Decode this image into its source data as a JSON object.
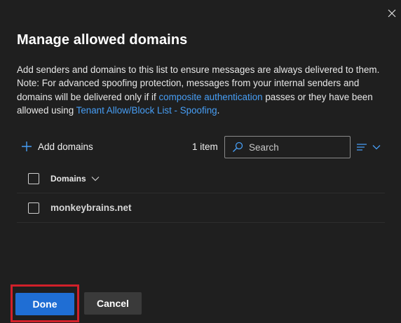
{
  "dialog": {
    "title": "Manage allowed domains",
    "close_icon": "close-icon",
    "description": {
      "text_before_link1": "Add senders and domains to this list to ensure messages are always delivered to them. Note: For advanced spoofing protection, messages from your internal senders and domains will be delivered only if if ",
      "link1": "composite authentication",
      "text_between_links": " passes or they have been allowed using ",
      "link2": "Tenant Allow/Block List - Spoofing",
      "text_after_link2": "."
    }
  },
  "toolbar": {
    "add_icon": "plus-icon",
    "add_label": "Add domains",
    "item_count": "1 item",
    "search": {
      "icon": "search-icon",
      "placeholder": "Search"
    },
    "filter_icon": "list-filter-icon",
    "filter_chevron_icon": "chevron-down-icon"
  },
  "table": {
    "column_header": "Domains",
    "header_chevron_icon": "chevron-down-icon",
    "rows": [
      {
        "domain": "monkeybrains.net"
      }
    ]
  },
  "footer": {
    "done_label": "Done",
    "cancel_label": "Cancel"
  },
  "colors": {
    "background": "#1f1f1f",
    "link": "#479ef5",
    "primary_button": "#1f6ed4",
    "secondary_button": "#3a3a3a",
    "highlight_border": "#d1202a"
  }
}
